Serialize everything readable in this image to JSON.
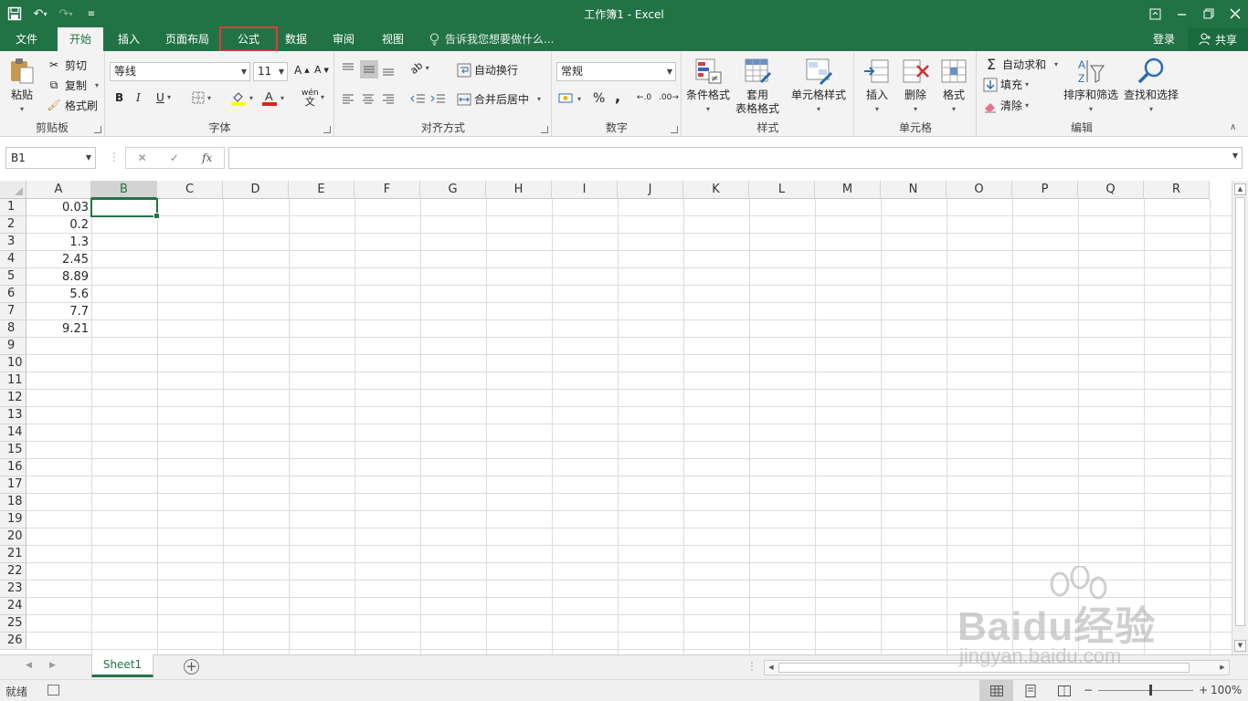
{
  "window": {
    "title": "工作簿1 - Excel"
  },
  "ribbon_tabs": [
    "文件",
    "开始",
    "插入",
    "页面布局",
    "公式",
    "数据",
    "审阅",
    "视图"
  ],
  "tell_me": "告诉我您想要做什么...",
  "account": {
    "login": "登录",
    "share": "共享"
  },
  "clipboard": {
    "paste": "粘贴",
    "cut": "剪切",
    "copy": "复制",
    "format_painter": "格式刷",
    "group": "剪贴板"
  },
  "font": {
    "name": "等线",
    "size": "11",
    "bold": "B",
    "italic": "I",
    "underline": "U",
    "group": "字体"
  },
  "alignment": {
    "wrap_text": "自动换行",
    "merge_center": "合并后居中",
    "group": "对齐方式"
  },
  "number": {
    "format": "常规",
    "percent": "%",
    "comma": ",",
    "group": "数字"
  },
  "styles": {
    "conditional_format": "条件格式",
    "format_table_1": "套用",
    "format_table_2": "表格格式",
    "cell_styles": "单元格样式",
    "group": "样式"
  },
  "cells_group": {
    "insert": "插入",
    "delete": "删除",
    "format": "格式",
    "group": "单元格"
  },
  "editing": {
    "autosum": "自动求和",
    "fill": "填充",
    "clear": "清除",
    "sort_filter": "排序和筛选",
    "find_select": "查找和选择",
    "group": "编辑"
  },
  "formula_bar": {
    "name_box": "B1",
    "fx": "fx",
    "value": ""
  },
  "columns": [
    "A",
    "B",
    "C",
    "D",
    "E",
    "F",
    "G",
    "H",
    "I",
    "J",
    "K",
    "L",
    "M",
    "N",
    "O",
    "P",
    "Q",
    "R"
  ],
  "rows": [
    "1",
    "2",
    "3",
    "4",
    "5",
    "6",
    "7",
    "8",
    "9",
    "10",
    "11",
    "12",
    "13",
    "14",
    "15",
    "16",
    "17",
    "18",
    "19",
    "20",
    "21",
    "22",
    "23",
    "24",
    "25",
    "26"
  ],
  "cells": {
    "A1": "0.03",
    "A2": "0.2",
    "A3": "1.3",
    "A4": "2.45",
    "A5": "8.89",
    "A6": "5.6",
    "A7": "7.7",
    "A8": "9.21"
  },
  "selected_cell": "B1",
  "sheets": [
    "Sheet1"
  ],
  "status": {
    "ready": "就绪",
    "zoom": "100%"
  },
  "watermark": {
    "line1": "Baidu经验",
    "line2": "jingyan.baidu.com"
  },
  "colors": {
    "excel_green": "#217346",
    "highlight_red": "#e53935"
  }
}
